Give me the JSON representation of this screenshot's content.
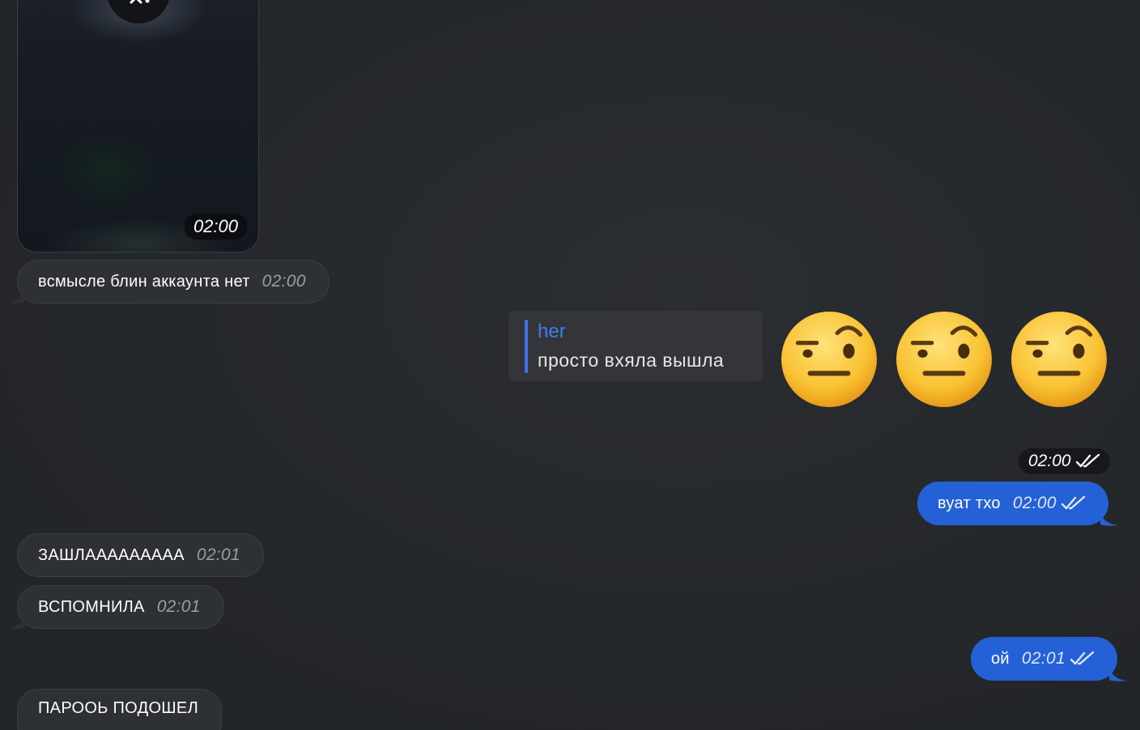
{
  "video_message": {
    "time": "02:00"
  },
  "messages": [
    {
      "text": "всмысле блин аккаунта нет",
      "time": "02:00"
    },
    {
      "reply_author": "her",
      "reply_text": "просто вхяла вышла",
      "emoji_count": 3,
      "time": "02:00"
    },
    {
      "text": "вуат тхо",
      "time": "02:00"
    },
    {
      "text": "ЗАШЛААААААААА",
      "time": "02:01"
    },
    {
      "text": "ВСПОМНИЛА",
      "time": "02:01"
    },
    {
      "text": "ой",
      "time": "02:01"
    },
    {
      "text": "ПАРООЬ ПОДОШЕЛ"
    }
  ],
  "colors": {
    "background": "#25282b",
    "incoming_bubble": "#2d3034",
    "outgoing_bubble": "#2561d6",
    "reply_accent": "#3b74ee"
  },
  "icons": [
    "close-icon",
    "double-check-icon",
    "raised-eyebrow-emoji"
  ]
}
